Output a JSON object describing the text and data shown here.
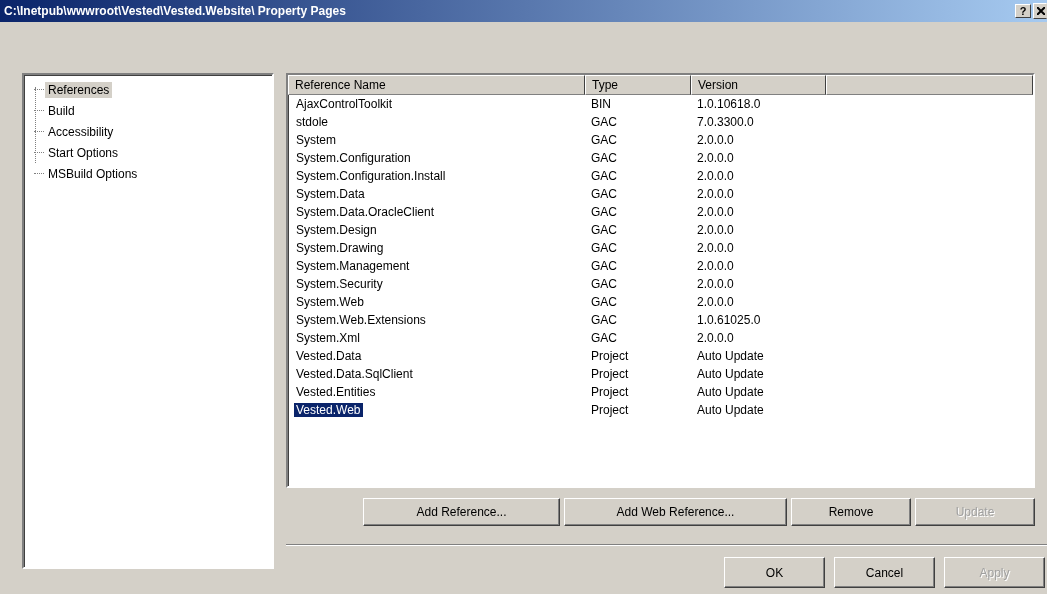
{
  "window": {
    "title": "C:\\Inetpub\\wwwroot\\Vested\\Vested.Website\\ Property Pages",
    "help_button": "?"
  },
  "sidebar": {
    "items": [
      {
        "label": "References",
        "selected": true
      },
      {
        "label": "Build",
        "selected": false
      },
      {
        "label": "Accessibility",
        "selected": false
      },
      {
        "label": "Start Options",
        "selected": false
      },
      {
        "label": "MSBuild Options",
        "selected": false
      }
    ]
  },
  "table": {
    "columns": [
      "Reference Name",
      "Type",
      "Version"
    ],
    "rows": [
      {
        "cells": [
          "AjaxControlToolkit",
          "BIN",
          "1.0.10618.0"
        ],
        "selected": false
      },
      {
        "cells": [
          "stdole",
          "GAC",
          "7.0.3300.0"
        ],
        "selected": false
      },
      {
        "cells": [
          "System",
          "GAC",
          "2.0.0.0"
        ],
        "selected": false
      },
      {
        "cells": [
          "System.Configuration",
          "GAC",
          "2.0.0.0"
        ],
        "selected": false
      },
      {
        "cells": [
          "System.Configuration.Install",
          "GAC",
          "2.0.0.0"
        ],
        "selected": false
      },
      {
        "cells": [
          "System.Data",
          "GAC",
          "2.0.0.0"
        ],
        "selected": false
      },
      {
        "cells": [
          "System.Data.OracleClient",
          "GAC",
          "2.0.0.0"
        ],
        "selected": false
      },
      {
        "cells": [
          "System.Design",
          "GAC",
          "2.0.0.0"
        ],
        "selected": false
      },
      {
        "cells": [
          "System.Drawing",
          "GAC",
          "2.0.0.0"
        ],
        "selected": false
      },
      {
        "cells": [
          "System.Management",
          "GAC",
          "2.0.0.0"
        ],
        "selected": false
      },
      {
        "cells": [
          "System.Security",
          "GAC",
          "2.0.0.0"
        ],
        "selected": false
      },
      {
        "cells": [
          "System.Web",
          "GAC",
          "2.0.0.0"
        ],
        "selected": false
      },
      {
        "cells": [
          "System.Web.Extensions",
          "GAC",
          "1.0.61025.0"
        ],
        "selected": false
      },
      {
        "cells": [
          "System.Xml",
          "GAC",
          "2.0.0.0"
        ],
        "selected": false
      },
      {
        "cells": [
          "Vested.Data",
          "Project",
          "Auto Update"
        ],
        "selected": false
      },
      {
        "cells": [
          "Vested.Data.SqlClient",
          "Project",
          "Auto Update"
        ],
        "selected": false
      },
      {
        "cells": [
          "Vested.Entities",
          "Project",
          "Auto Update"
        ],
        "selected": false
      },
      {
        "cells": [
          "Vested.Web",
          "Project",
          "Auto Update"
        ],
        "selected": true
      }
    ]
  },
  "reference_buttons": [
    {
      "label": "Add Reference...",
      "disabled": false
    },
    {
      "label": "Add Web Reference...",
      "disabled": false
    },
    {
      "label": "Remove",
      "disabled": false
    },
    {
      "label": "Update",
      "disabled": true
    }
  ],
  "dialog_buttons": [
    {
      "label": "OK",
      "disabled": false
    },
    {
      "label": "Cancel",
      "disabled": false
    },
    {
      "label": "Apply",
      "disabled": true
    }
  ]
}
